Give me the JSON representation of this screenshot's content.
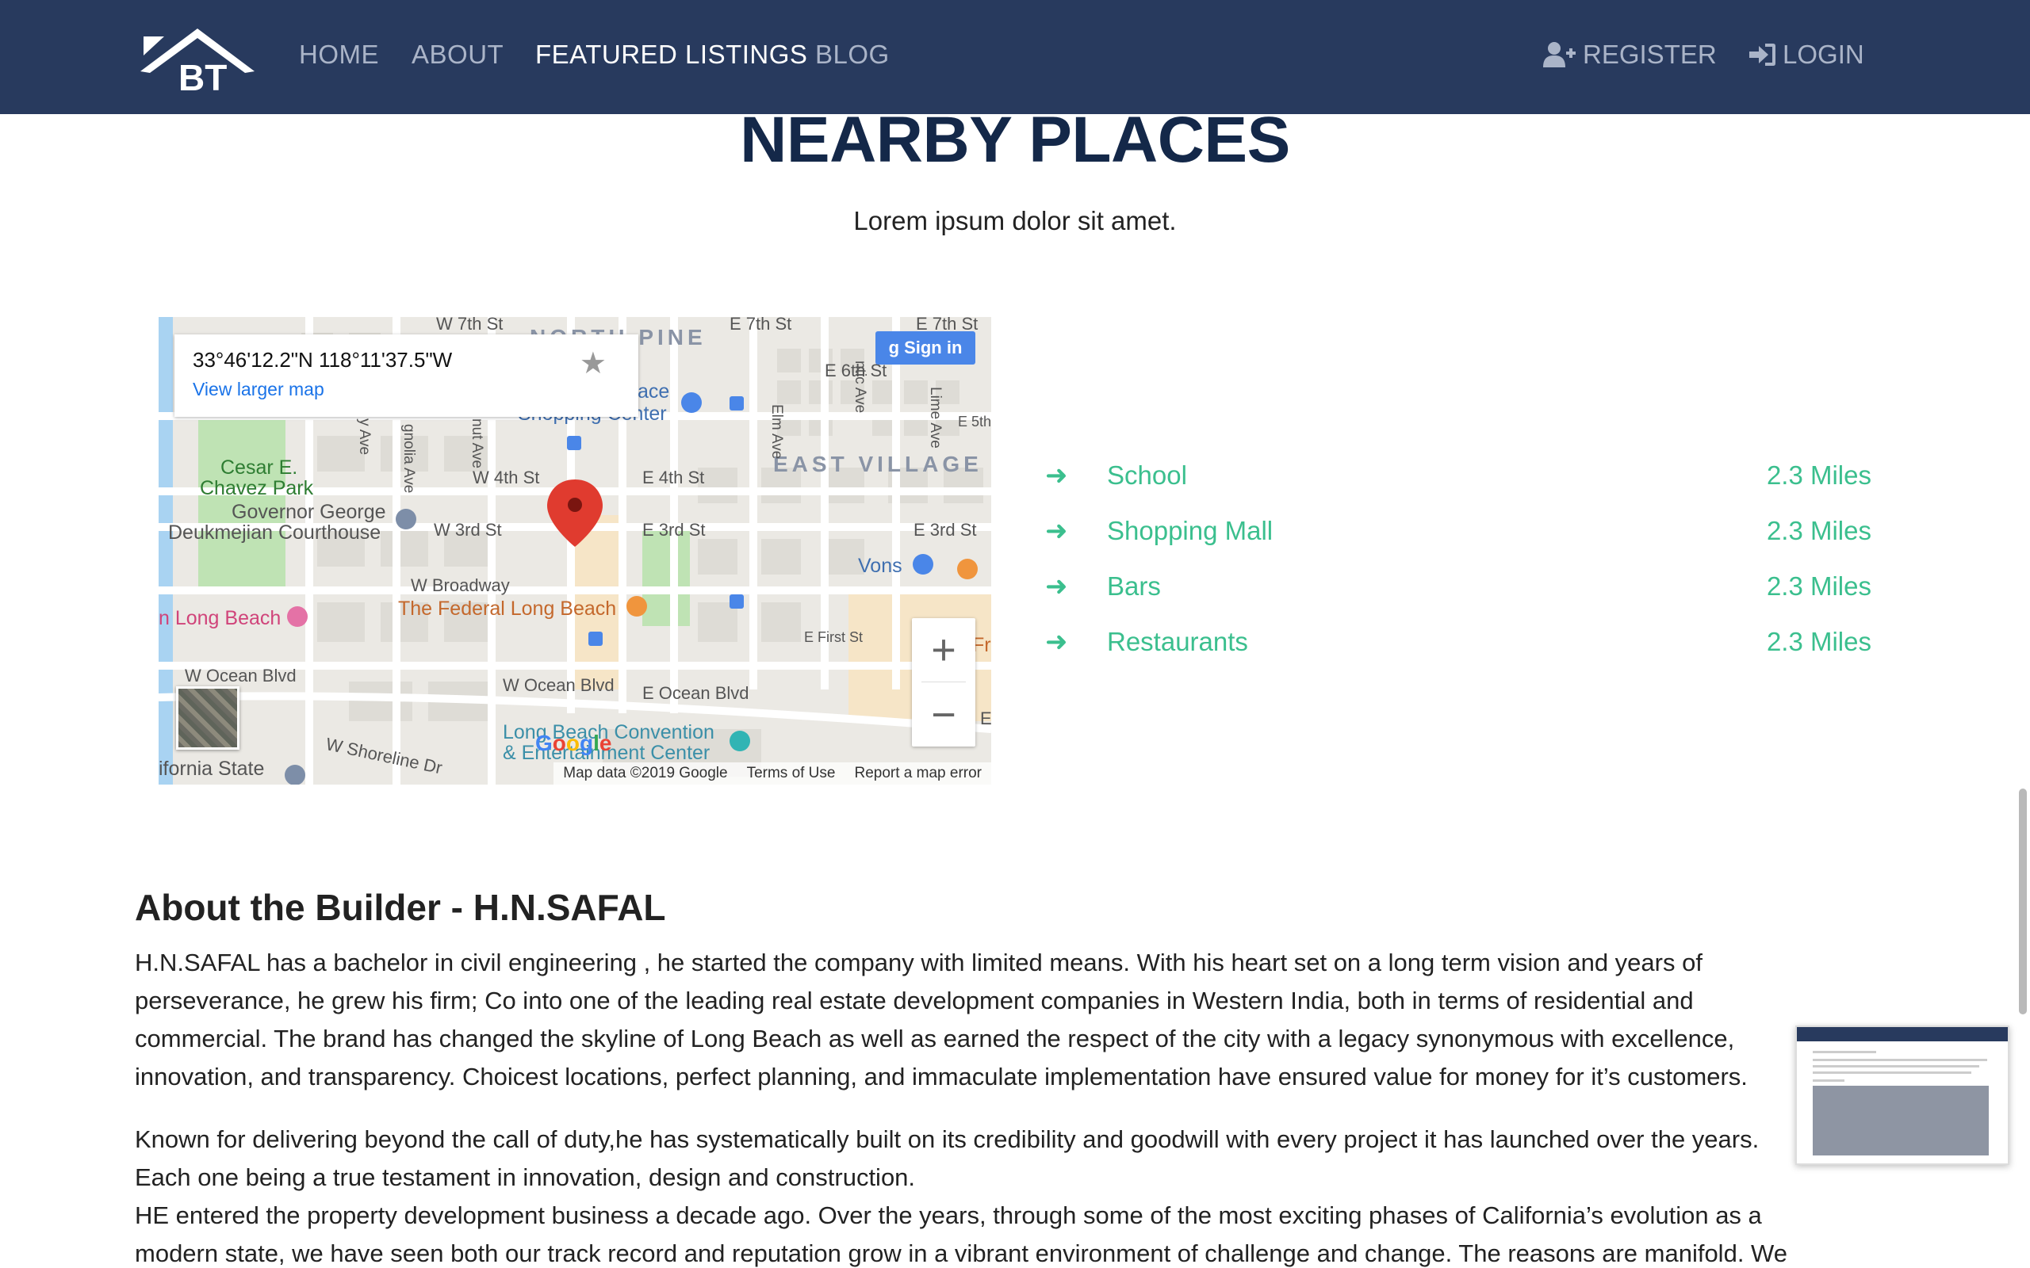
{
  "navbar": {
    "brand_text": "BT",
    "links": [
      "HOME",
      "ABOUT",
      "FEATURED LISTINGS",
      "BLOG"
    ],
    "active": "FEATURED LISTINGS",
    "register": "REGISTER",
    "login": "LOGIN",
    "background": "#283a5e"
  },
  "section": {
    "title": "NEARBY PLACES",
    "subtitle": "Lorem ipsum dolor sit amet."
  },
  "map": {
    "coords": "33°46'12.2\"N 118°11'37.5\"W",
    "larger_map": "View larger map",
    "sign_in": "Sign in",
    "google": "Google",
    "footer": {
      "data": "Map data ©2019 Google",
      "terms": "Terms of Use",
      "report": "Report a map error"
    },
    "labels": {
      "north_pine": "NORTH PINE",
      "east_village": "EAST VILLAGE",
      "w7th": "W 7th St",
      "e7th": "E 7th St",
      "e7th2": "E 7th St",
      "e6th": "E 6th St",
      "e5th": "E 5th",
      "shopping": "Shopping Center",
      "place": "ace",
      "elm": "Elm Ave",
      "atlantic": "ntic Ave",
      "lime": "Lime Ave",
      "cesar": "Cesar E.",
      "chavez": "Chavez Park",
      "governor": "Governor George",
      "deukmejian": "Deukmejian Courthouse",
      "w4th": "W 4th St",
      "e4th": "E 4th St",
      "w3rd": "W 3rd St",
      "e3rd": "E 3rd St",
      "e3rd2": "E 3rd St",
      "magnolia": "gnolia Ave",
      "pacific": "nut Ave",
      "ave": "y Ave",
      "broadway": "W Broadway",
      "federal": "The Federal Long Beach",
      "vons": "Vons",
      "longbeach": "n Long Beach",
      "efirst": "E First St",
      "fre": "Fre",
      "wocean": "W Ocean Blvd",
      "wocean2": "W Ocean Blvd",
      "eocean": "E Ocean Blvd",
      "lbcc1": "Long Beach Convention",
      "lbcc2": "& Entertainment Center",
      "shoreline": "W Shoreline Dr",
      "calstate": "ifornia State",
      "e_edge": "E"
    }
  },
  "places": [
    {
      "name": "School",
      "distance": "2.3 Miles"
    },
    {
      "name": "Shopping Mall",
      "distance": "2.3 Miles"
    },
    {
      "name": "Bars",
      "distance": "2.3 Miles"
    },
    {
      "name": "Restaurants",
      "distance": "2.3 Miles"
    }
  ],
  "about": {
    "title_prefix": "About the Builder - ",
    "title_name": "H.N.SAFAL",
    "p1": [
      "H.N.SAFAL has a bachelor in civil engineering , he started the company with limited means. With his heart set on a long term vision and years of",
      "perseverance, he grew his firm; Co into one of the leading real estate development companies in Western India, both in terms of residential and",
      "commercial. The brand has changed the skyline of Long Beach as well as earned the respect of the city with a legacy synonymous with excellence,",
      "innovation, and transparency. Choicest locations, perfect planning, and immaculate implementation have ensured value for money for it’s customers."
    ],
    "p2": [
      "Known for delivering beyond the call of duty,he has systematically built on its credibility and goodwill with every project it has launched over the years.",
      "Each one being a true testament in innovation, design and construction.",
      "HE entered the property development business a decade ago. Over the years, through some of the most exciting phases of California’s evolution as a",
      "modern state, we have seen both our track record and reputation grow in a vibrant environment of challenge and change. The reasons are manifold. We"
    ]
  },
  "colors": {
    "accent": "#3bbf8e",
    "heading": "#142849",
    "nav_bg": "#283a5e",
    "nav_text": "#aab4c8"
  }
}
